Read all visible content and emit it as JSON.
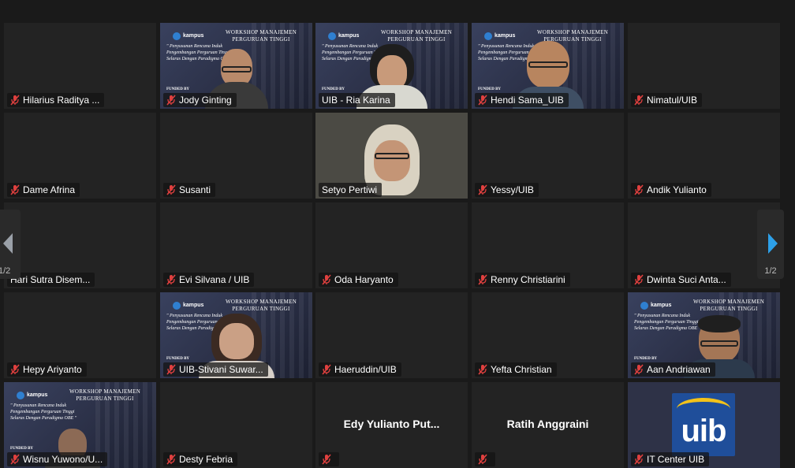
{
  "pagination": {
    "left_page": "1/2",
    "right_page": "1/2"
  },
  "banner": {
    "title": "WORKSHOP MANAJEMEN PERGURUAN TINGGI",
    "subtitle": "\" Penyusunan Rencana Induk Pengembangan Perguruan Tinggi Selaras Dengan Paradigma OBE \"",
    "funded": "FUNDED BY",
    "logo_text": "kampus"
  },
  "colors": {
    "active_border": "#c6e05a",
    "nav_arrow": "#2da0e8",
    "mic_muted": "#e0403f",
    "uib_blue": "#1f4e9a",
    "uib_yellow": "#f2c21a"
  },
  "participants": [
    {
      "name": "Hilarius Raditya ...",
      "muted": true,
      "video": "none"
    },
    {
      "name": "Jody Ginting",
      "muted": true,
      "video": "banner-man"
    },
    {
      "name": "UIB - Ria Karina",
      "muted": false,
      "video": "banner-woman",
      "active": true
    },
    {
      "name": "Hendi Sama_UIB",
      "muted": true,
      "video": "banner-man-smile"
    },
    {
      "name": "Nimatul/UIB",
      "muted": true,
      "video": "none"
    },
    {
      "name": "Dame Afrina",
      "muted": true,
      "video": "none"
    },
    {
      "name": "Susanti",
      "muted": true,
      "video": "none"
    },
    {
      "name": "Setyo Pertiwi",
      "muted": false,
      "video": "hijab"
    },
    {
      "name": "Yessy/UIB",
      "muted": true,
      "video": "none"
    },
    {
      "name": "Andik Yulianto",
      "muted": true,
      "video": "none"
    },
    {
      "name": "Hari Sutra Disem...",
      "muted": false,
      "video": "none"
    },
    {
      "name": "Evi Silvana / UIB",
      "muted": true,
      "video": "none"
    },
    {
      "name": "Oda Haryanto",
      "muted": true,
      "video": "none"
    },
    {
      "name": "Renny Christiarini",
      "muted": true,
      "video": "none"
    },
    {
      "name": "Dwinta Suci Anta...",
      "muted": true,
      "video": "none"
    },
    {
      "name": "Hepy Ariyanto",
      "muted": true,
      "video": "none"
    },
    {
      "name": "UIB-Stivani Suwar...",
      "muted": true,
      "video": "banner-woman-down"
    },
    {
      "name": "Haeruddin/UIB",
      "muted": true,
      "video": "none"
    },
    {
      "name": "Yefta Christian",
      "muted": true,
      "video": "none"
    },
    {
      "name": "Aan Andriawan",
      "muted": true,
      "video": "banner-man-down"
    },
    {
      "name": "Wisnu Yuwono/U...",
      "muted": true,
      "video": "banner-partial"
    },
    {
      "name": "Desty Febria",
      "muted": true,
      "video": "none"
    },
    {
      "name": "",
      "muted": true,
      "video": "name",
      "center_name": "Edy Yulianto Put..."
    },
    {
      "name": "",
      "muted": true,
      "video": "name",
      "center_name": "Ratih Anggraini"
    },
    {
      "name": "IT Center UIB",
      "muted": true,
      "video": "uib-logo",
      "logo_text": "uib"
    }
  ]
}
